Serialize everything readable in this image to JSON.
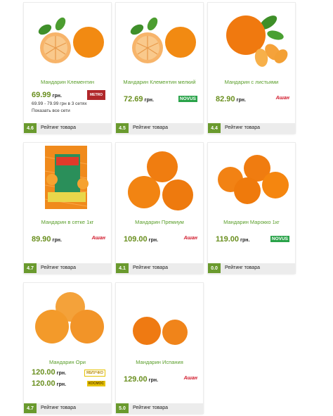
{
  "currency": "грн.",
  "rating_label": "Рейтинг товара",
  "products": [
    {
      "name": "Мандарин Клементин",
      "price": "69.99",
      "range": "69.99 - 79.99 грн в 3 сетях",
      "all_networks": "Показать все сети",
      "store": "metro-logo",
      "rating": "4.6"
    },
    {
      "name": "Мандарин Клементин мелкий",
      "price": "72.69",
      "store": "NOVUS",
      "rating": "4.5"
    },
    {
      "name": "Мандарин с листьями",
      "price": "82.90",
      "store": "Ашан",
      "rating": "4.4"
    },
    {
      "name": "Мандарин в сетке 1кг",
      "price": "89.90",
      "store": "Ашан",
      "rating": "4.7"
    },
    {
      "name": "Мандарин Премиум",
      "price": "109.00",
      "store": "Ашан",
      "rating": "4.1"
    },
    {
      "name": "Мандарин Марокко 1кг",
      "price": "119.00",
      "store": "NOVUS",
      "rating": "0.0"
    },
    {
      "name": "Мандарин Ори",
      "prices": [
        "120.00",
        "120.00"
      ],
      "stores": [
        "store-logo-1",
        "store-logo-2"
      ],
      "rating": "4.7"
    },
    {
      "name": "Мандарин Испания",
      "price": "129.00",
      "store": "Ашан",
      "rating": "5.0"
    }
  ]
}
